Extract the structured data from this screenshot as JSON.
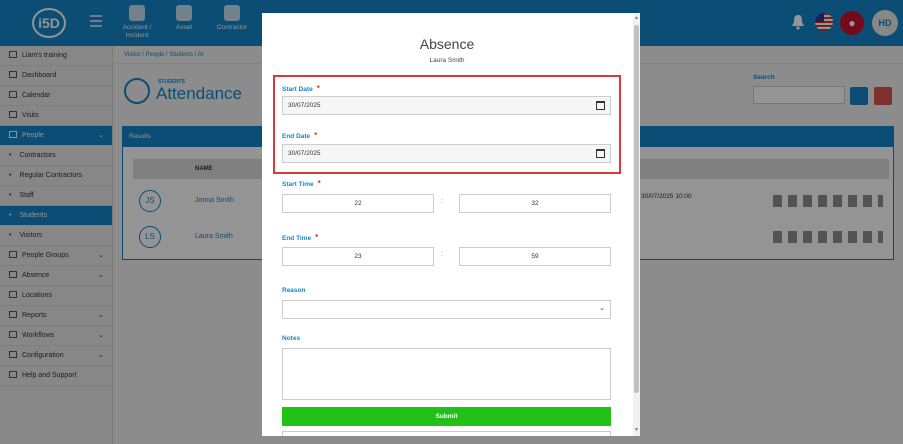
{
  "topbar": {
    "logo": "i5D",
    "modules": [
      {
        "label": "Accident / Incident",
        "icon": "first-aid-icon"
      },
      {
        "label": "Asset",
        "icon": "boxes-icon"
      },
      {
        "label": "Contractor",
        "icon": "hardhat-icon"
      }
    ],
    "user_initials": "HD"
  },
  "sidebar": {
    "items": [
      {
        "label": "Liam's training"
      },
      {
        "label": "Dashboard"
      },
      {
        "label": "Calendar"
      },
      {
        "label": "Visits"
      },
      {
        "label": "People"
      },
      {
        "label": "Contractors"
      },
      {
        "label": "Regular Contractors"
      },
      {
        "label": "Staff"
      },
      {
        "label": "Students"
      },
      {
        "label": "Visitors"
      },
      {
        "label": "People Groups"
      },
      {
        "label": "Absence"
      },
      {
        "label": "Locations"
      },
      {
        "label": "Reports"
      },
      {
        "label": "Workflows"
      },
      {
        "label": "Configuration"
      },
      {
        "label": "Help and Support"
      }
    ]
  },
  "main": {
    "breadcrumb": "Visitor / People / Students / At",
    "page_subtitle": "STUDENTS",
    "page_title": "Attendance",
    "search_label": "Search",
    "results_title": "Results",
    "column_name": "NAME",
    "rows": [
      {
        "initials": "JS",
        "name": "Jonna Smith",
        "time": "30/07/2025 10:00"
      },
      {
        "initials": "LS",
        "name": "Laura Smith",
        "time": ""
      }
    ]
  },
  "modal": {
    "title": "Absence",
    "subtitle": "Laura Smith",
    "start_date_label": "Start Date",
    "start_date_value": "30/07/2025",
    "end_date_label": "End Date",
    "end_date_value": "30/07/2025",
    "required_mark": "*",
    "start_time_label": "Start Time",
    "start_hour": "22",
    "start_minute": "32",
    "end_time_label": "End Time",
    "end_hour": "23",
    "end_minute": "59",
    "time_separator": ":",
    "reason_label": "Reason",
    "reason_value": "",
    "notes_label": "Notes",
    "notes_value": "",
    "submit_label": "Submit"
  },
  "colors": {
    "accent": "#1386c8",
    "submit": "#21c116",
    "highlight": "#d83a3a",
    "required": "#d83a3a"
  }
}
